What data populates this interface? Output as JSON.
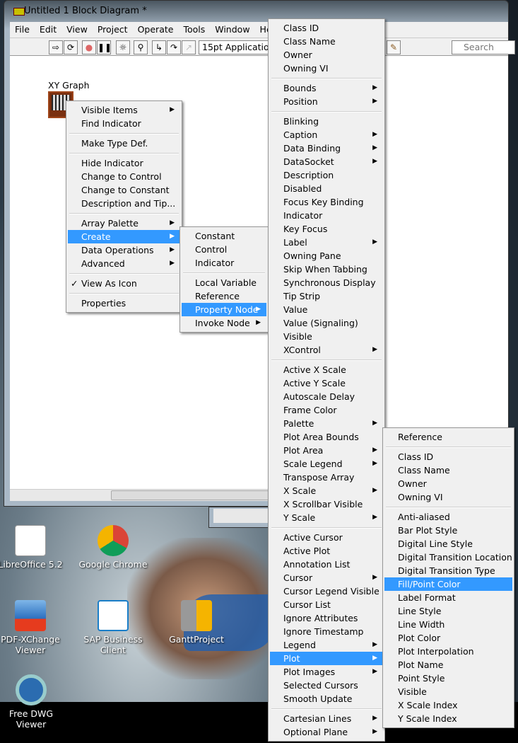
{
  "window": {
    "title": "Untitled 1 Block Diagram *"
  },
  "menubar": [
    "File",
    "Edit",
    "View",
    "Project",
    "Operate",
    "Tools",
    "Window",
    "Help"
  ],
  "toolbar": {
    "font": "15pt Application Font",
    "search_placeholder": "Search"
  },
  "node": {
    "label": "XY Graph"
  },
  "context_menu": [
    {
      "label": "Visible Items",
      "sub": true
    },
    {
      "label": "Find Indicator"
    },
    {
      "sep": true
    },
    {
      "label": "Make Type Def."
    },
    {
      "sep": true
    },
    {
      "label": "Hide Indicator"
    },
    {
      "label": "Change to Control"
    },
    {
      "label": "Change to Constant"
    },
    {
      "label": "Description and Tip..."
    },
    {
      "sep": true
    },
    {
      "label": "Array Palette",
      "sub": true
    },
    {
      "label": "Create",
      "sub": true,
      "highlighted": true
    },
    {
      "label": "Data Operations",
      "sub": true
    },
    {
      "label": "Advanced",
      "sub": true
    },
    {
      "sep": true
    },
    {
      "label": "View As Icon",
      "checked": true
    },
    {
      "sep": true
    },
    {
      "label": "Properties"
    }
  ],
  "create_menu": [
    {
      "label": "Constant"
    },
    {
      "label": "Control"
    },
    {
      "label": "Indicator"
    },
    {
      "sep": true
    },
    {
      "label": "Local Variable"
    },
    {
      "label": "Reference"
    },
    {
      "label": "Property Node",
      "sub": true,
      "highlighted": true
    },
    {
      "label": "Invoke Node",
      "sub": true
    }
  ],
  "property_menu": [
    {
      "label": "Class ID"
    },
    {
      "label": "Class Name"
    },
    {
      "label": "Owner"
    },
    {
      "label": "Owning VI"
    },
    {
      "sep": true
    },
    {
      "label": "Bounds",
      "sub": true
    },
    {
      "label": "Position",
      "sub": true
    },
    {
      "sep": true
    },
    {
      "label": "Blinking"
    },
    {
      "label": "Caption",
      "sub": true
    },
    {
      "label": "Data Binding",
      "sub": true
    },
    {
      "label": "DataSocket",
      "sub": true
    },
    {
      "label": "Description"
    },
    {
      "label": "Disabled"
    },
    {
      "label": "Focus Key Binding"
    },
    {
      "label": "Indicator"
    },
    {
      "label": "Key Focus"
    },
    {
      "label": "Label",
      "sub": true
    },
    {
      "label": "Owning Pane"
    },
    {
      "label": "Skip When Tabbing"
    },
    {
      "label": "Synchronous Display"
    },
    {
      "label": "Tip Strip"
    },
    {
      "label": "Value"
    },
    {
      "label": "Value (Signaling)"
    },
    {
      "label": "Visible"
    },
    {
      "label": "XControl",
      "sub": true
    },
    {
      "sep": true
    },
    {
      "label": "Active X Scale"
    },
    {
      "label": "Active Y Scale"
    },
    {
      "label": "Autoscale Delay"
    },
    {
      "label": "Frame Color"
    },
    {
      "label": "Palette",
      "sub": true
    },
    {
      "label": "Plot Area Bounds"
    },
    {
      "label": "Plot Area",
      "sub": true
    },
    {
      "label": "Scale Legend",
      "sub": true
    },
    {
      "label": "Transpose Array"
    },
    {
      "label": "X Scale",
      "sub": true
    },
    {
      "label": "X Scrollbar Visible"
    },
    {
      "label": "Y Scale",
      "sub": true
    },
    {
      "sep": true
    },
    {
      "label": "Active Cursor"
    },
    {
      "label": "Active Plot"
    },
    {
      "label": "Annotation List"
    },
    {
      "label": "Cursor",
      "sub": true
    },
    {
      "label": "Cursor Legend Visible"
    },
    {
      "label": "Cursor List"
    },
    {
      "label": "Ignore Attributes"
    },
    {
      "label": "Ignore Timestamp"
    },
    {
      "label": "Legend",
      "sub": true
    },
    {
      "label": "Plot",
      "sub": true,
      "highlighted": true
    },
    {
      "label": "Plot Images",
      "sub": true
    },
    {
      "label": "Selected Cursors"
    },
    {
      "label": "Smooth Update"
    },
    {
      "sep": true
    },
    {
      "label": "Cartesian Lines",
      "sub": true
    },
    {
      "label": "Optional Plane",
      "sub": true
    }
  ],
  "plot_menu": [
    {
      "label": "Reference"
    },
    {
      "sep": true
    },
    {
      "label": "Class ID"
    },
    {
      "label": "Class Name"
    },
    {
      "label": "Owner"
    },
    {
      "label": "Owning VI"
    },
    {
      "sep": true
    },
    {
      "label": "Anti-aliased"
    },
    {
      "label": "Bar Plot Style"
    },
    {
      "label": "Digital Line Style"
    },
    {
      "label": "Digital Transition Location"
    },
    {
      "label": "Digital Transition Type"
    },
    {
      "label": "Fill/Point Color",
      "highlighted": true
    },
    {
      "label": "Label Format"
    },
    {
      "label": "Line Style"
    },
    {
      "label": "Line Width"
    },
    {
      "label": "Plot Color"
    },
    {
      "label": "Plot Interpolation"
    },
    {
      "label": "Plot Name"
    },
    {
      "label": "Point Style"
    },
    {
      "label": "Visible"
    },
    {
      "label": "X Scale Index"
    },
    {
      "label": "Y Scale Index"
    }
  ],
  "desktop_icons": [
    "LibreOffice 5.2",
    "Google Chrome",
    "PDF-XChange Viewer",
    "SAP Business Client",
    "GanttProject",
    "Free DWG Viewer"
  ],
  "colors": {
    "highlight": "#3399ff",
    "menu_bg": "#f0f0f0"
  }
}
